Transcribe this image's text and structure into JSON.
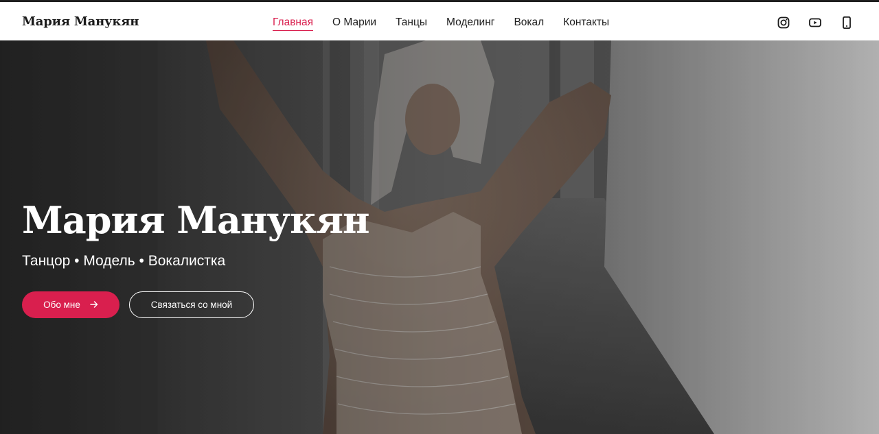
{
  "header": {
    "logo": "Мария Манукян",
    "nav": [
      {
        "label": "Главная",
        "active": true
      },
      {
        "label": "О Марии"
      },
      {
        "label": "Танцы"
      },
      {
        "label": "Моделинг"
      },
      {
        "label": "Вокал"
      },
      {
        "label": "Контакты"
      }
    ],
    "social": [
      "instagram-icon",
      "youtube-icon",
      "phone-icon"
    ]
  },
  "hero": {
    "title": "Мария Манукян",
    "subtitle": "Танцор • Модель • Вокалистка",
    "primary_button": "Обо мне",
    "secondary_button": "Связаться со мной"
  },
  "colors": {
    "accent": "#d91f4e",
    "text": "#1e1e1e",
    "hero_text": "#ffffff"
  }
}
